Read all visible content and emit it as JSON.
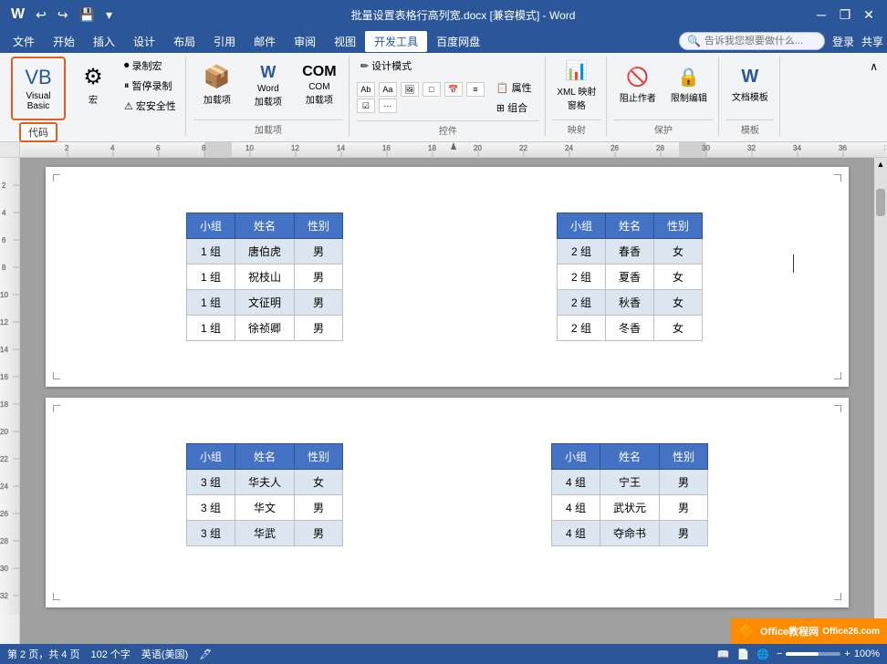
{
  "titleBar": {
    "title": "批量设置表格行高列宽.docx [兼容模式] - Word",
    "windowControls": [
      "minimize",
      "restore",
      "close"
    ],
    "quickAccessIcons": [
      "save",
      "undo",
      "redo",
      "customize"
    ]
  },
  "menuBar": {
    "items": [
      "文件",
      "开始",
      "插入",
      "设计",
      "布局",
      "引用",
      "邮件",
      "审阅",
      "视图",
      "开发工具",
      "百度网盘"
    ],
    "activeItem": "开发工具"
  },
  "ribbon": {
    "groups": [
      {
        "label": "代码",
        "labelHighlighted": true,
        "items": [
          {
            "id": "visual-basic",
            "label": "Visual Basic",
            "type": "large",
            "highlighted": true
          },
          {
            "id": "macro",
            "label": "宏",
            "type": "large"
          },
          {
            "id": "record-macro",
            "label": "录制宏",
            "type": "small"
          },
          {
            "id": "pause-record",
            "label": "暂停录制",
            "type": "small"
          },
          {
            "id": "macro-security",
            "label": "宏安全性",
            "type": "small"
          }
        ]
      },
      {
        "label": "加载项",
        "items": [
          {
            "id": "add-ins",
            "label": "加载项",
            "type": "large"
          },
          {
            "id": "word-add-ins",
            "label": "Word 加载项",
            "type": "large"
          },
          {
            "id": "com-add-ins",
            "label": "COM 加载项",
            "type": "large"
          }
        ]
      },
      {
        "label": "控件",
        "items": [
          {
            "id": "design-mode",
            "label": "设计模式",
            "type": "small"
          },
          {
            "id": "properties",
            "label": "属性",
            "type": "small"
          },
          {
            "id": "group",
            "label": "组合",
            "type": "small"
          }
        ]
      },
      {
        "label": "映射",
        "items": [
          {
            "id": "xml-map",
            "label": "XML 映射窗格",
            "type": "large"
          }
        ]
      },
      {
        "label": "保护",
        "items": [
          {
            "id": "block-authors",
            "label": "阻止作者",
            "type": "large"
          },
          {
            "id": "restrict-edit",
            "label": "限制编辑",
            "type": "large"
          }
        ]
      },
      {
        "label": "模板",
        "items": [
          {
            "id": "doc-template",
            "label": "文档模板",
            "type": "large"
          }
        ]
      }
    ]
  },
  "search": {
    "placeholder": "告诉我您想要做什么..."
  },
  "userActions": {
    "login": "登录",
    "share": "共享"
  },
  "statusBar": {
    "pageInfo": "第 2 页，共 4 页",
    "wordCount": "102 个字",
    "language": "英语(美国)",
    "zoom": "100%",
    "viewIcons": [
      "read-mode",
      "print-layout",
      "web-layout"
    ]
  },
  "tables": [
    {
      "id": "table1",
      "headers": [
        "小组",
        "姓名",
        "性别"
      ],
      "rows": [
        [
          "1 组",
          "唐伯虎",
          "男"
        ],
        [
          "1 组",
          "祝枝山",
          "男"
        ],
        [
          "1 组",
          "文征明",
          "男"
        ],
        [
          "1 组",
          "徐祯卿",
          "男"
        ]
      ]
    },
    {
      "id": "table2",
      "headers": [
        "小组",
        "姓名",
        "性别"
      ],
      "rows": [
        [
          "2 组",
          "春香",
          "女"
        ],
        [
          "2 组",
          "夏香",
          "女"
        ],
        [
          "2 组",
          "秋香",
          "女"
        ],
        [
          "2 组",
          "冬香",
          "女"
        ]
      ]
    },
    {
      "id": "table3",
      "headers": [
        "小组",
        "姓名",
        "性别"
      ],
      "rows": [
        [
          "3 组",
          "华夫人",
          "女"
        ],
        [
          "3 组",
          "华文",
          "男"
        ],
        [
          "3 组",
          "华武",
          "男"
        ]
      ]
    },
    {
      "id": "table4",
      "headers": [
        "小组",
        "姓名",
        "性别"
      ],
      "rows": [
        [
          "4 组",
          "宁王",
          "男"
        ],
        [
          "4 组",
          "武状元",
          "男"
        ],
        [
          "4 组",
          "夺命书",
          "男"
        ]
      ]
    }
  ],
  "watermark": {
    "text": "Office教程网",
    "url": "Office26.com"
  }
}
